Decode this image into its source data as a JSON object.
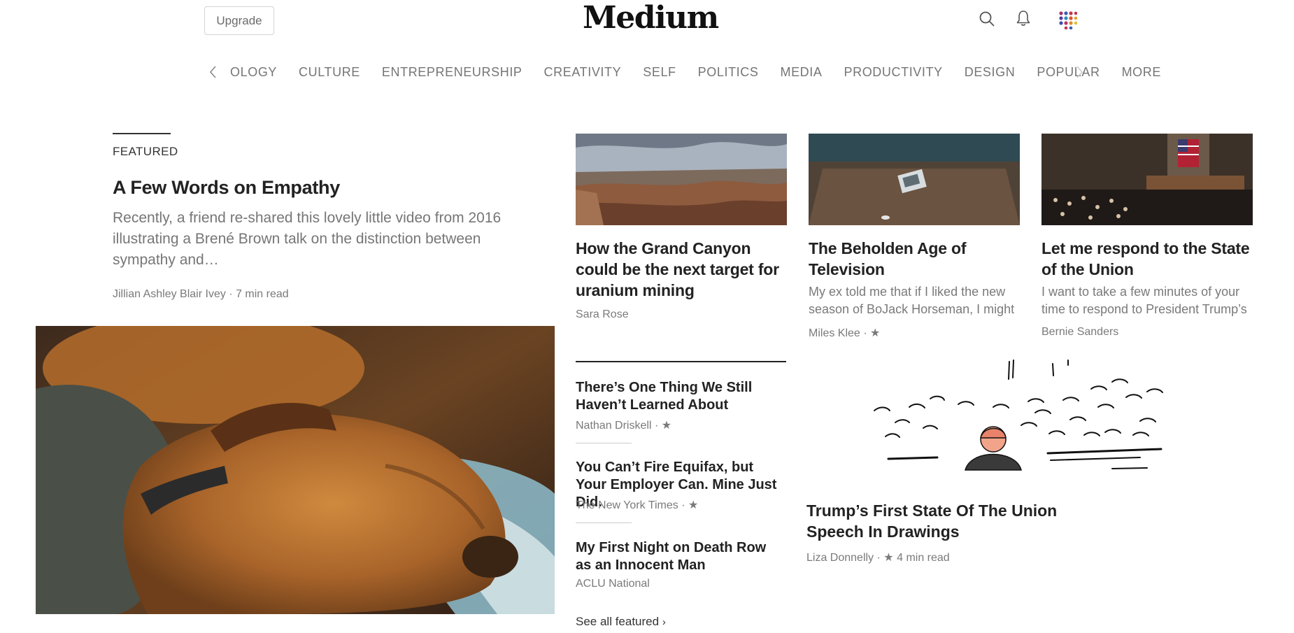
{
  "header": {
    "upgrade_label": "Upgrade",
    "logo_text": "Medium",
    "icons": [
      "search-icon",
      "bell-icon",
      "apps-icon"
    ]
  },
  "nav": {
    "topics": [
      "OLOGY",
      "CULTURE",
      "ENTREPRENEURSHIP",
      "CREATIVITY",
      "SELF",
      "POLITICS",
      "MEDIA",
      "PRODUCTIVITY",
      "DESIGN",
      "POPULAR",
      "MORE"
    ]
  },
  "featured": {
    "label": "FEATURED",
    "title": "A Few Words on Empathy",
    "excerpt": "Recently, a friend re-shared this lovely little video from 2016 illustrating a Brené Brown talk on the distinction between sympathy and…",
    "author": "Jillian Ashley Blair Ivey",
    "read_time": "7 min read"
  },
  "cards": [
    {
      "title": "How the Grand Canyon could be the next target for uranium mining",
      "excerpt": "",
      "author": "Sara Rose",
      "star": false
    },
    {
      "title": "The Beholden Age of Television",
      "excerpt": "My ex told me that if I liked the new season of BoJack Horseman, I might",
      "author": "Miles Klee",
      "star": true
    },
    {
      "title": "Let me respond to the State of the Union",
      "excerpt": "I want to take a few minutes of your time to respond to President Trump’s",
      "author": "Bernie Sanders",
      "star": false
    }
  ],
  "list": [
    {
      "title": "There’s One Thing We Still Haven’t Learned About",
      "author": "Nathan Driskell"
    },
    {
      "title": "You Can’t Fire Equifax, but Your Employer Can. Mine Just Did.",
      "author": "The New York Times"
    },
    {
      "title": "My First Night on Death Row as an Innocent Man",
      "author": "ACLU National"
    }
  ],
  "see_all": "See all featured",
  "big_story": {
    "title": "Trump’s First State Of The Union Speech In Drawings",
    "author": "Liza Donnelly",
    "read_time": "4 min read"
  },
  "colors": {
    "accent": "#111111",
    "muted": "#757575"
  }
}
